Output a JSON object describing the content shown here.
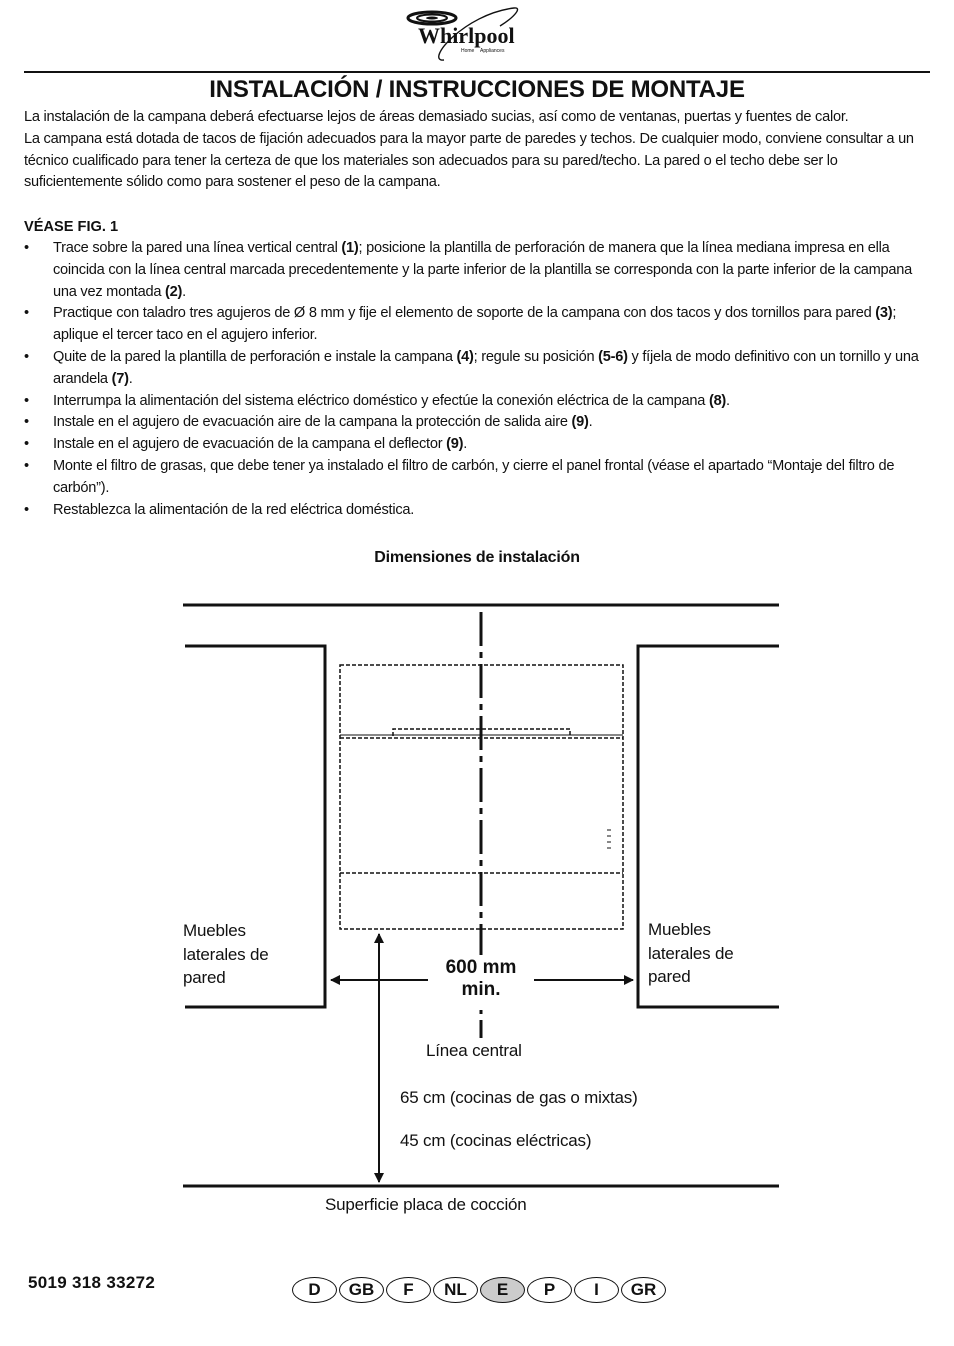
{
  "brand": {
    "name": "Whirlpool",
    "tagline_left": "Home",
    "tagline_right": "Appliances"
  },
  "page_title": "INSTALACIÓN / INSTRUCCIONES DE MONTAJE",
  "intro": [
    "La instalación de la campana deberá efectuarse lejos de áreas demasiado sucias, así como de ventanas, puertas y fuentes de calor.",
    "La campana está dotada de tacos de fijación adecuados para la mayor parte de paredes y techos. De cualquier modo, conviene consultar a un técnico cualificado para tener la certeza de que los materiales son adecuados para su pared/techo. La pared o el techo debe ser lo suficientemente sólido como para sostener el peso de la campana."
  ],
  "see_fig": "VÉASE FIG. 1",
  "bullet_glyph": "•",
  "steps": [
    {
      "parts": [
        {
          "t": "Trace sobre la pared una línea vertical central "
        },
        {
          "b": "(1)"
        },
        {
          "t": "; posicione la plantilla de perforación de manera que la línea mediana impresa en ella coincida con la línea central marcada precedentemente y la parte inferior de la plantilla se corresponda con la parte inferior de la campana una vez montada "
        },
        {
          "b": "(2)"
        },
        {
          "t": "."
        }
      ]
    },
    {
      "parts": [
        {
          "t": "Practique con taladro tres agujeros de Ø 8 mm y fije el elemento de soporte de la campana con dos tacos y dos tornillos para pared "
        },
        {
          "b": "(3)"
        },
        {
          "t": "; aplique el tercer taco en el agujero inferior."
        }
      ]
    },
    {
      "parts": [
        {
          "t": "Quite de la pared la plantilla de perforación  e instale la campana "
        },
        {
          "b": "(4)"
        },
        {
          "t": "; regule su posición "
        },
        {
          "b": "(5-6)"
        },
        {
          "t": " y fíjela de modo definitivo con un tornillo y una arandela "
        },
        {
          "b": "(7)"
        },
        {
          "t": "."
        }
      ]
    },
    {
      "parts": [
        {
          "t": "Interrumpa la alimentación del sistema eléctrico doméstico y efectúe la conexión eléctrica de la campana "
        },
        {
          "b": "(8)"
        },
        {
          "t": "."
        }
      ]
    },
    {
      "parts": [
        {
          "t": "Instale en el agujero de evacuación aire de la campana la protección de salida aire "
        },
        {
          "b": "(9)"
        },
        {
          "t": "."
        }
      ]
    },
    {
      "parts": [
        {
          "t": "Instale en el agujero de evacuación de la campana el deflector "
        },
        {
          "b": "(9)"
        },
        {
          "t": "."
        }
      ]
    },
    {
      "parts": [
        {
          "t": "Monte el filtro de grasas, que debe tener ya instalado el filtro de carbón, y cierre el panel frontal (véase el apartado “Montaje del filtro de carbón”)."
        }
      ]
    },
    {
      "parts": [
        {
          "t": "Restablezca la alimentación de la red eléctrica doméstica."
        }
      ]
    }
  ],
  "diagram": {
    "title": "Dimensiones de instalación",
    "left_cabinet_label": [
      "Muebles",
      "laterales de",
      "pared"
    ],
    "right_cabinet_label": [
      "Muebles",
      "laterales de",
      "pared"
    ],
    "width_dimension": [
      "600 mm",
      "min."
    ],
    "center_line_label": "Línea central",
    "height_gas": "65 cm (cocinas de gas o mixtas)",
    "height_electric": "45 cm (cocinas eléctricas)",
    "hob_surface_label": "Superficie placa de cocción"
  },
  "footer": {
    "doc_code": "5019 318 33272",
    "languages": [
      "D",
      "GB",
      "F",
      "NL",
      "E",
      "P",
      "I",
      "GR"
    ],
    "active_language": "E",
    "active_color": "#cccccc"
  }
}
